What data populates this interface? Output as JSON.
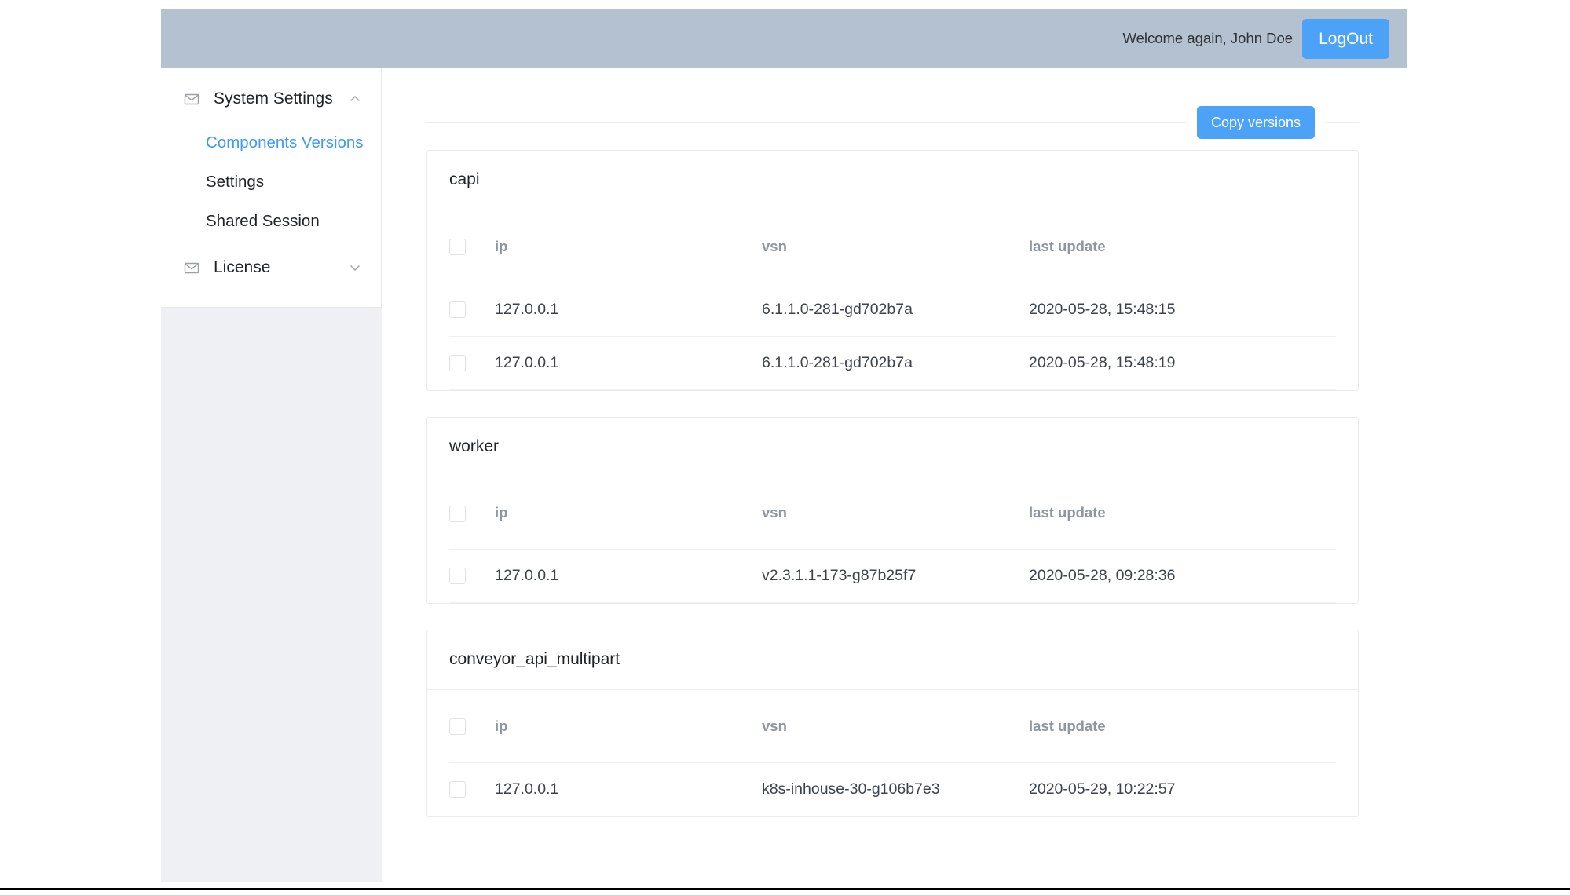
{
  "header": {
    "welcome_text": "Welcome again, John Doe",
    "logout_label": "LogOut",
    "bar_color": "#b3c1d1",
    "accent_color": "#4ba2f7"
  },
  "sidebar": {
    "groups": [
      {
        "label": "System Settings",
        "icon": "mail-icon",
        "chevron": "chevron-up-icon",
        "expanded": true,
        "items": [
          {
            "label": "Components Versions",
            "active": true
          },
          {
            "label": "Settings",
            "active": false
          },
          {
            "label": "Shared Session",
            "active": false
          }
        ]
      },
      {
        "label": "License",
        "icon": "mail-icon",
        "chevron": "chevron-down-icon",
        "expanded": false,
        "items": []
      }
    ]
  },
  "toolbar": {
    "copy_versions_label": "Copy versions"
  },
  "columns": {
    "checkbox": "",
    "ip": "ip",
    "vsn": "vsn",
    "last_update": "last update"
  },
  "cards": [
    {
      "title": "capi",
      "rows": [
        {
          "ip": "127.0.0.1",
          "vsn": "6.1.1.0-281-gd702b7a",
          "last_update": "2020-05-28, 15:48:15"
        },
        {
          "ip": "127.0.0.1",
          "vsn": "6.1.1.0-281-gd702b7a",
          "last_update": "2020-05-28, 15:48:19"
        }
      ]
    },
    {
      "title": "worker",
      "rows": [
        {
          "ip": "127.0.0.1",
          "vsn": "v2.3.1.1-173-g87b25f7",
          "last_update": "2020-05-28, 09:28:36"
        }
      ]
    },
    {
      "title": "conveyor_api_multipart",
      "rows": [
        {
          "ip": "127.0.0.1",
          "vsn": "k8s-inhouse-30-g106b7e3",
          "last_update": "2020-05-29, 10:22:57"
        }
      ]
    }
  ]
}
